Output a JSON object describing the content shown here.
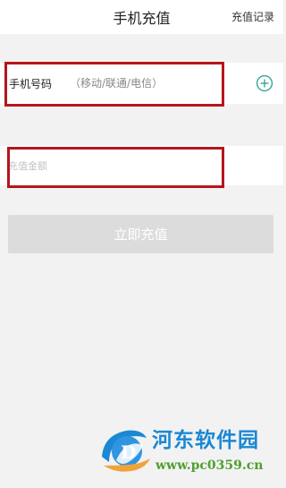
{
  "header": {
    "title": "手机充值",
    "history_link": "充值记录"
  },
  "phone": {
    "label": "手机号码",
    "placeholder": "（移动/联通/电信）",
    "add_icon": "plus-circle-icon"
  },
  "amount": {
    "placeholder": "充值金额"
  },
  "submit": {
    "label": "立即充值"
  },
  "watermark": {
    "name": "河东软件园",
    "url": "www.pc0359.cn",
    "logo_icon": "watermark-logo-icon"
  },
  "colors": {
    "background": "#f2f2f2",
    "accent": "#2a9d8f",
    "highlight_border": "#b5151b",
    "button_disabled": "#dcdcdc"
  }
}
